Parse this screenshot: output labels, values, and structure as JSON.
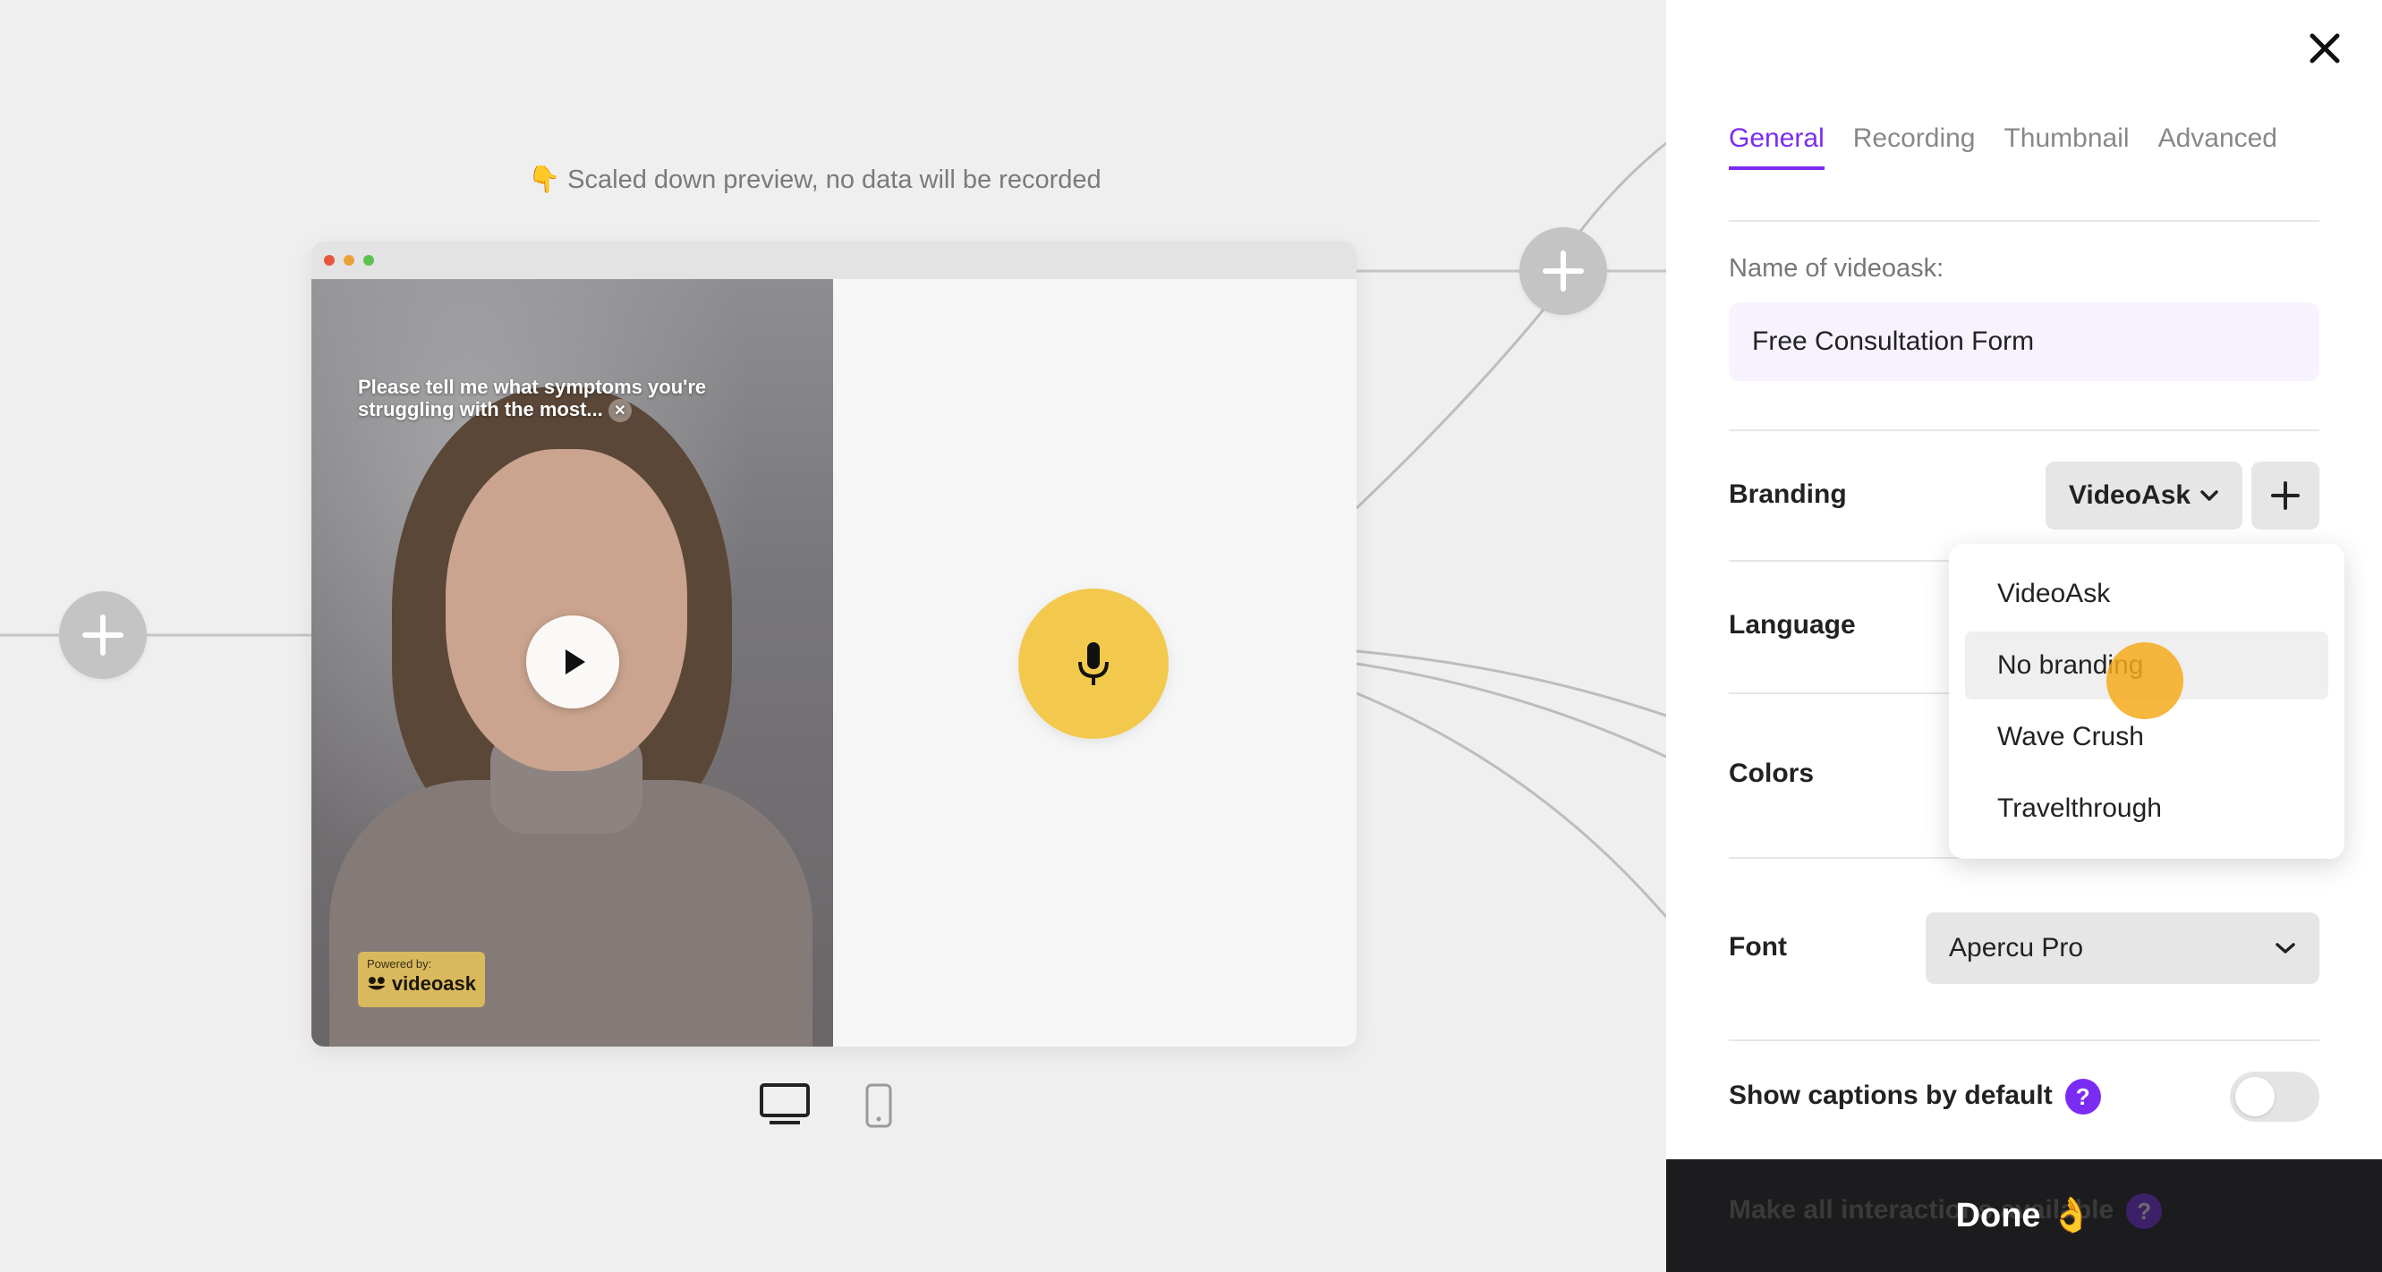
{
  "canvas": {
    "preview_note": "👇 Scaled down preview, no data will be recorded",
    "video_caption": "Please tell me what symptoms you're struggling with the most...",
    "powered_by_label": "Powered by:",
    "powered_by_brand": "videoask",
    "mic_color": "#f2c94c"
  },
  "panel": {
    "tabs": [
      {
        "label": "General",
        "active": true
      },
      {
        "label": "Recording",
        "active": false
      },
      {
        "label": "Thumbnail",
        "active": false
      },
      {
        "label": "Advanced",
        "active": false
      }
    ],
    "name_label": "Name of videoask:",
    "name_value": "Free Consultation Form",
    "branding_label": "Branding",
    "branding_value": "VideoAsk",
    "branding_options": [
      "VideoAsk",
      "No branding",
      "Wave Crush",
      "Travelthrough"
    ],
    "branding_hovered": "No branding",
    "language_label": "Language",
    "colors_label": "Colors",
    "font_label": "Font",
    "font_value": "Apercu Pro",
    "captions_label": "Show captions by default",
    "captions_enabled": false,
    "interactions_label": "Make all interactions available",
    "help_glyph": "?",
    "done_label": "Done 👌",
    "accent_color": "#7b2cf2"
  }
}
